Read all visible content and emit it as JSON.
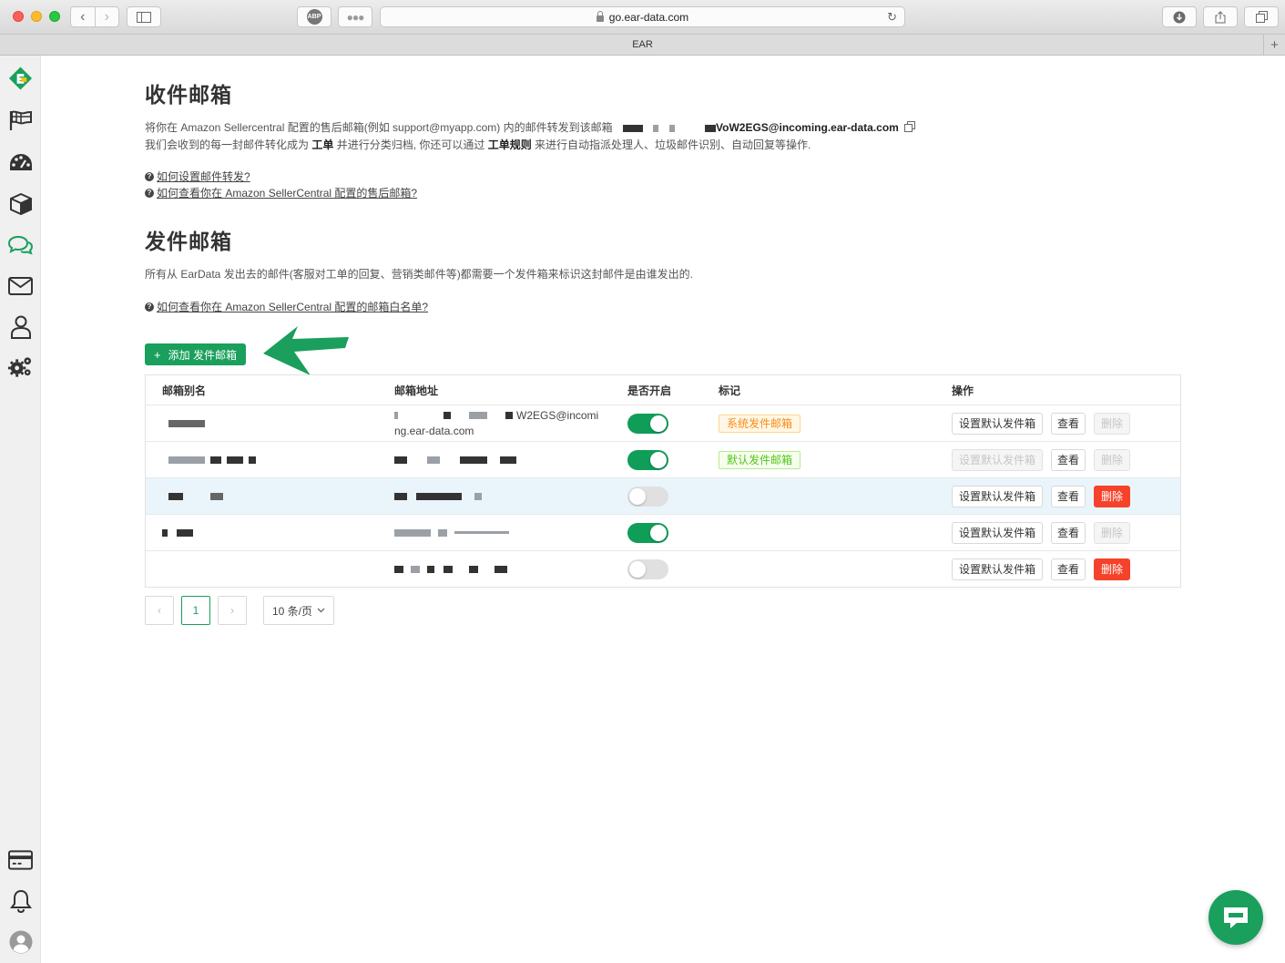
{
  "browser": {
    "url": "go.ear-data.com",
    "tab_title": "EAR",
    "abp_label": "ABP"
  },
  "sidebar": {
    "items": [
      "logo-icon",
      "flag-icon",
      "dashboard-icon",
      "box-icon",
      "chat-icon",
      "mail-icon",
      "user-icon",
      "settings-icon",
      "card-icon",
      "bell-icon",
      "avatar-icon"
    ],
    "active_color": "#1a9f5c"
  },
  "inbox": {
    "title": "收件邮箱",
    "desc1": "将你在 Amazon Sellercentral 配置的售后邮箱(例如 support@myapp.com) 内的邮件转发到该邮箱",
    "inbox_address": "VoW2EGS@incoming.ear-data.com",
    "desc2_a": "我们会收到的每一封邮件转化成为 ",
    "desc2_ticket": "工单",
    "desc2_b": " 并进行分类归档, 你还可以通过 ",
    "desc2_rules": "工单规则",
    "desc2_c": " 来进行自动指派处理人、垃圾邮件识别、自动回复等操作.",
    "help1": "如何设置邮件转发?",
    "help2": "如何查看你在 Amazon SellerCentral 配置的售后邮箱?"
  },
  "outbox": {
    "title": "发件邮箱",
    "desc": "所有从 EarData 发出去的邮件(客服对工单的回复、营销类邮件等)都需要一个发件箱来标识这封邮件是由谁发出的.",
    "help": "如何查看你在 Amazon SellerCentral 配置的邮箱白名单?",
    "add_button": "添加 发件邮箱",
    "add_plus": "+"
  },
  "table": {
    "headers": [
      "邮箱别名",
      "邮箱地址",
      "是否开启",
      "标记",
      "操作"
    ],
    "rows": [
      {
        "email_line1": "W2EGS@incomi",
        "email_line2": "ng.ear-data.com",
        "enabled": true,
        "tag": "系统发件邮箱",
        "tag_color": "orange",
        "delete_enabled": false,
        "set_default_enabled": true
      },
      {
        "email_line1": "",
        "email_line2": "",
        "enabled": true,
        "tag": "默认发件邮箱",
        "tag_color": "green",
        "delete_enabled": false,
        "set_default_enabled": false
      },
      {
        "email_line1": "",
        "email_line2": "",
        "enabled": false,
        "tag": "",
        "tag_color": "",
        "delete_enabled": true,
        "set_default_enabled": true
      },
      {
        "email_line1": "",
        "email_line2": "",
        "enabled": true,
        "tag": "",
        "tag_color": "",
        "delete_enabled": false,
        "set_default_enabled": true
      },
      {
        "email_line1": "",
        "email_line2": "",
        "enabled": false,
        "tag": "",
        "tag_color": "",
        "delete_enabled": true,
        "set_default_enabled": true
      }
    ],
    "action_set_default": "设置默认发件箱",
    "action_view": "查看",
    "action_delete": "删除"
  },
  "pagination": {
    "current_page": "1",
    "prev": "‹",
    "next": "›",
    "page_size": "10 条/页"
  },
  "colors": {
    "primary": "#1a9f5c",
    "danger": "#f5422a",
    "highlight_row": "#eaf5fb"
  }
}
